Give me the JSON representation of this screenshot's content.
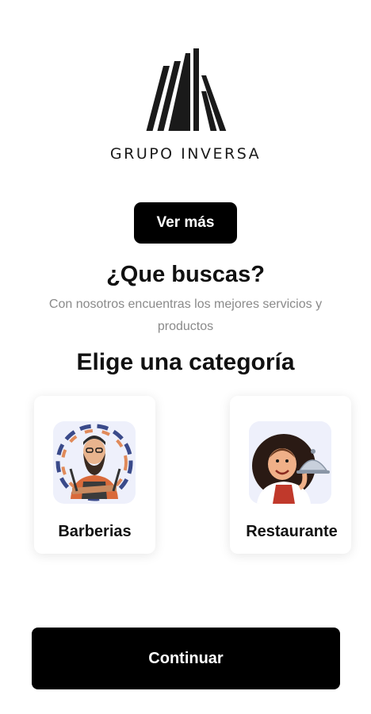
{
  "brand": {
    "name": "GRUPO INVERSA"
  },
  "actions": {
    "see_more_label": "Ver más",
    "continue_label": "Continuar"
  },
  "intro": {
    "question": "¿Que buscas?",
    "subtitle": "Con nosotros encuentras los mejores servicios y productos"
  },
  "categories": {
    "heading": "Elige una categoría",
    "items": [
      {
        "label": "Barberias",
        "icon": "barber-illustration"
      },
      {
        "label": "Restaurante",
        "icon": "waiter-illustration"
      }
    ]
  },
  "colors": {
    "primary": "#000000",
    "on_primary": "#ffffff",
    "subtitle_text": "#8a8a8a",
    "card_background": "#ffffff"
  }
}
